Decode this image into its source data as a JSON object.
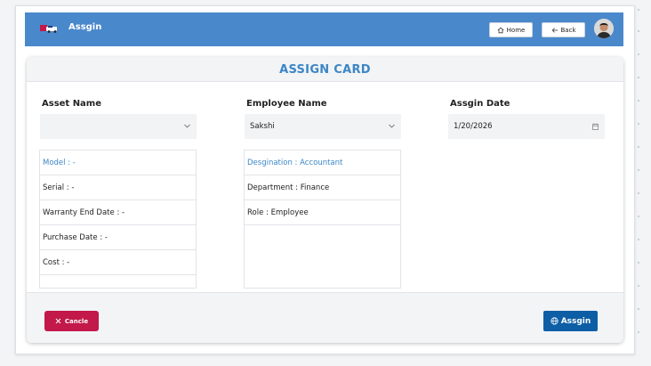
{
  "header": {
    "app_title": "Assgin",
    "home_label": "Home",
    "back_label": "Back"
  },
  "card": {
    "title": "ASSIGN CARD"
  },
  "form": {
    "asset_name_label": "Asset Name",
    "asset_name_value": "",
    "employee_name_label": "Employee Name",
    "employee_name_value": "Sakshi",
    "assign_date_label": "Assgin Date",
    "assign_date_value": "1/20/2026"
  },
  "asset_details": [
    "Model : -",
    "Serial : -",
    "Warranty End Date : -",
    "Purchase Date : -",
    "Cost : -"
  ],
  "employee_details": [
    "Desgination : Accountant",
    "Department : Finance",
    "Role : Employee"
  ],
  "footer": {
    "cancel_label": "Cancle",
    "assign_label": "Assgin"
  },
  "colors": {
    "topbar": "#4a88cc",
    "accent": "#3d86c6",
    "cancel": "#c2184a",
    "assign": "#0e5ea6"
  }
}
